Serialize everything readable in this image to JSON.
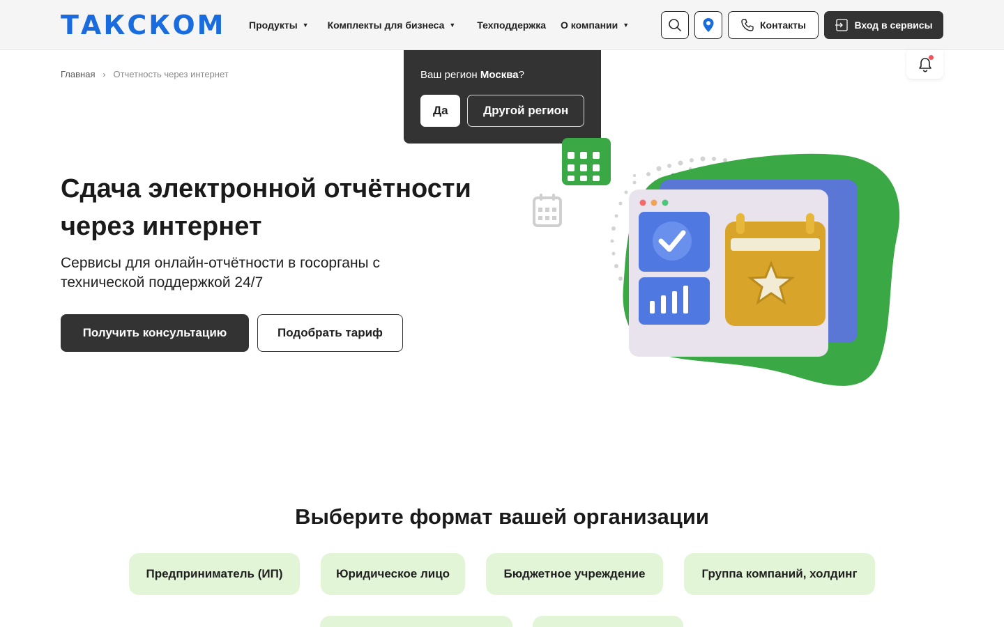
{
  "header": {
    "logo": "ТАКСКОМ",
    "nav": [
      {
        "label": "Продукты",
        "has_dropdown": true
      },
      {
        "label": "Комплекты для бизнеса",
        "has_dropdown": true
      },
      {
        "label": "Техподдержка",
        "has_dropdown": false
      },
      {
        "label": "О компании",
        "has_dropdown": true
      }
    ],
    "search_icon": "search-icon",
    "location_icon": "location-pin-icon",
    "contacts_label": "Контакты",
    "login_label": "Вход в сервисы",
    "accent_color": "#1a6cde"
  },
  "breadcrumb": {
    "home": "Главная",
    "separator": "›",
    "current": "Отчетность через интернет"
  },
  "region_popup": {
    "question_prefix": "Ваш регион ",
    "region": "Москва",
    "question_suffix": "?",
    "yes_label": "Да",
    "other_label": "Другой регион"
  },
  "hero": {
    "title": "Сдача электронной отчётности через интернет",
    "subtitle": "Сервисы для онлайн-отчётности в госорганы с технической поддержкой 24/7",
    "consult_label": "Получить консультацию",
    "tariff_label": "Подобрать тариф"
  },
  "section": {
    "title": "Выберите формат вашей организации",
    "chips": [
      "Предприниматель (ИП)",
      "Юридическое лицо",
      "Бюджетное учреждение",
      "Группа компаний, холдинг",
      "",
      ""
    ]
  },
  "colors": {
    "dark": "#333333",
    "chip_bg": "#e3f5d7",
    "green_blob": "#3aa845",
    "notification_dot": "#f2545b"
  }
}
